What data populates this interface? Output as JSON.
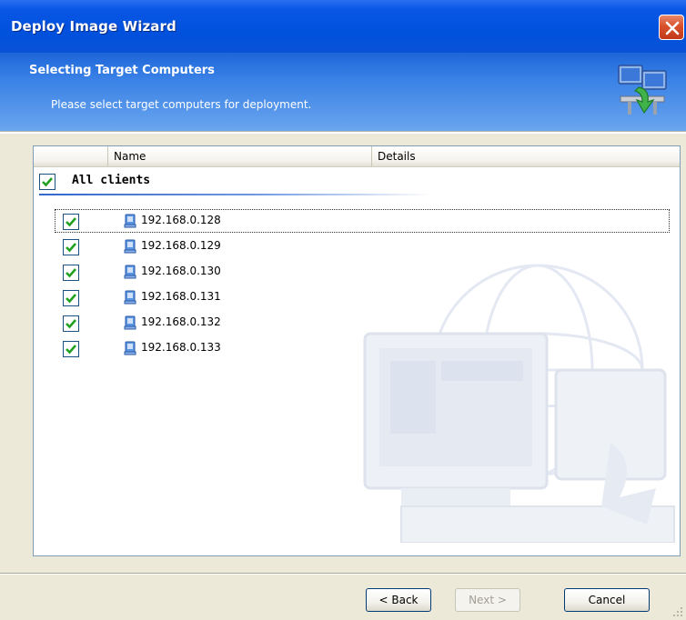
{
  "window": {
    "title": "Deploy Image Wizard"
  },
  "header": {
    "title": "Selecting Target Computers",
    "subtitle": "Please select target computers for deployment."
  },
  "list": {
    "columns": [
      "",
      "Name",
      "Details"
    ],
    "group": {
      "label": "All clients",
      "checked": true
    },
    "items": [
      {
        "name": "192.168.0.128",
        "checked": true,
        "focused": true
      },
      {
        "name": "192.168.0.129",
        "checked": true
      },
      {
        "name": "192.168.0.130",
        "checked": true
      },
      {
        "name": "192.168.0.131",
        "checked": true
      },
      {
        "name": "192.168.0.132",
        "checked": true
      },
      {
        "name": "192.168.0.133",
        "checked": true
      }
    ]
  },
  "buttons": {
    "back_label": "< Back",
    "next_label": "Next >",
    "cancel_label": "Cancel"
  },
  "icons": {
    "close": "close-icon",
    "header": "network-computers-icon",
    "item": "computer-icon",
    "check": "checkbox-checked-icon"
  },
  "colors": {
    "titlebar": "#0051dd",
    "header": "#3a82e6",
    "check": "#22a022",
    "close": "#d8512b"
  }
}
